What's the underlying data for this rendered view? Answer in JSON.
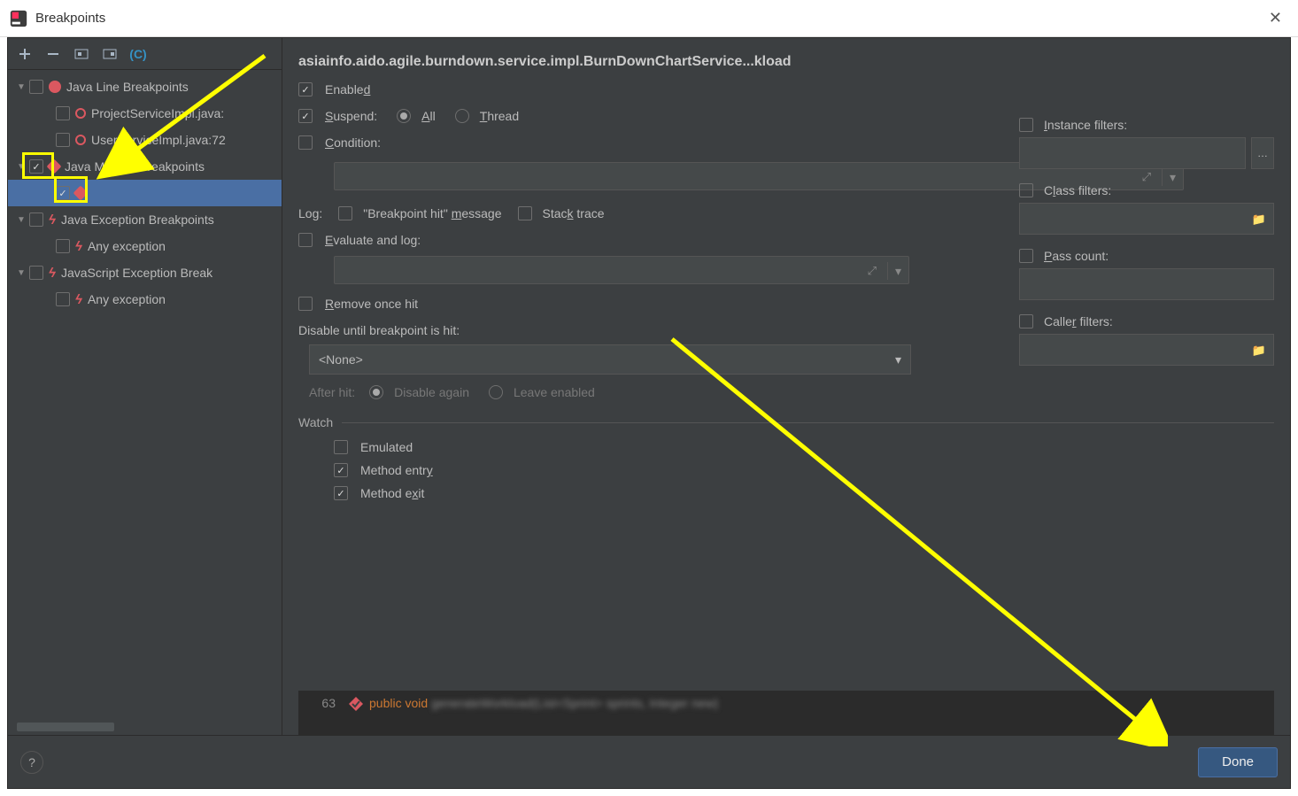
{
  "titlebar": {
    "title": "Breakpoints"
  },
  "header": "asiainfo.aido.agile.burndown.service.impl.BurnDownChartService...kload",
  "tree": {
    "g0": {
      "label": "Java Line Breakpoints",
      "c0": "ProjectServiceImpl.java:",
      "c1": "UserServiceImpl.java:72"
    },
    "g1": {
      "label": "Java Method Breakpoints",
      "c0": ""
    },
    "g2": {
      "label": "Java Exception Breakpoints",
      "c0": "Any exception"
    },
    "g3": {
      "label": "JavaScript Exception Break",
      "c0": "Any exception"
    }
  },
  "opts": {
    "enabled": "Enabled",
    "suspend": "Suspend:",
    "all": "All",
    "thread": "Thread",
    "condition": "Condition:",
    "log": "Log:",
    "bphitmsg": "\"Breakpoint hit\" message",
    "stacktrace": "Stack trace",
    "evallog": "Evaluate and log:",
    "removeonce": "Remove once hit",
    "disableuntil": "Disable until breakpoint is hit:",
    "none": "<None>",
    "afterhit": "After hit:",
    "disableagain": "Disable again",
    "leaveenabled": "Leave enabled"
  },
  "filters": {
    "instance": "Instance filters:",
    "class": "Class filters:",
    "pass": "Pass count:",
    "caller": "Caller filters:"
  },
  "watch": {
    "title": "Watch",
    "emulated": "Emulated",
    "entry": "Method entry",
    "exit": "Method exit"
  },
  "code": {
    "line": "63",
    "kw1": "public",
    "kw2": "void"
  },
  "buttons": {
    "done": "Done"
  }
}
